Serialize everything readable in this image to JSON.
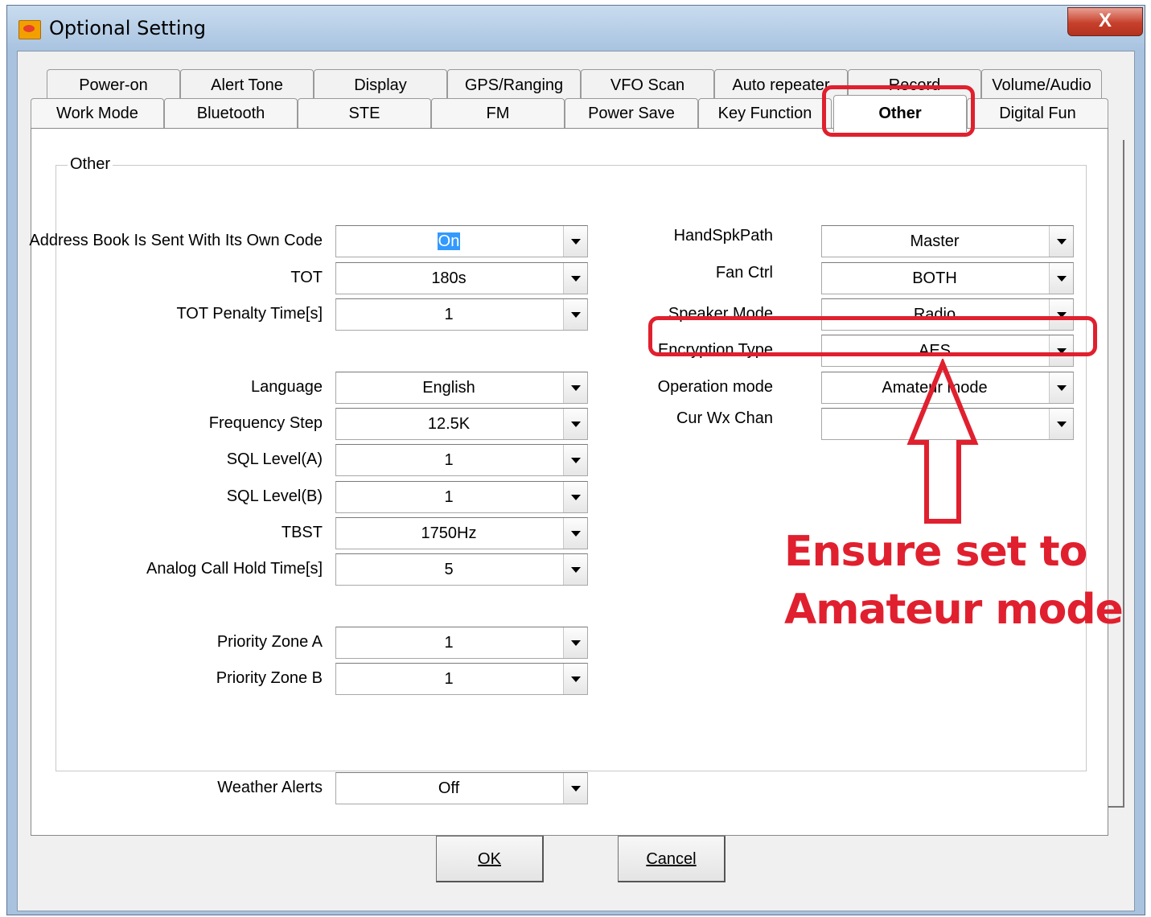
{
  "window": {
    "title": "Optional Setting",
    "close_label": "X"
  },
  "tabs_row1": [
    "Power-on",
    "Alert Tone",
    "Display",
    "GPS/Ranging",
    "VFO Scan",
    "Auto repeater",
    "Record",
    "Volume/Audio"
  ],
  "tabs_row2": [
    "Work Mode",
    "Bluetooth",
    "STE",
    "FM",
    "Power Save",
    "Key Function",
    "Other",
    "Digital Fun"
  ],
  "active_tab": "Other",
  "group_label": "Other",
  "left_fields": [
    {
      "label": "Address Book Is Sent With Its Own Code",
      "value": "On"
    },
    {
      "label": "TOT",
      "value": "180s"
    },
    {
      "label": "TOT Penalty Time[s]",
      "value": "1"
    },
    {
      "label": "Language",
      "value": "English"
    },
    {
      "label": "Frequency Step",
      "value": "12.5K"
    },
    {
      "label": "SQL Level(A)",
      "value": "1"
    },
    {
      "label": "SQL Level(B)",
      "value": "1"
    },
    {
      "label": "TBST",
      "value": "1750Hz"
    },
    {
      "label": "Analog Call Hold Time[s]",
      "value": "5"
    },
    {
      "label": "Priority Zone A",
      "value": "1"
    },
    {
      "label": "Priority Zone B",
      "value": "1"
    },
    {
      "label": "Weather Alerts",
      "value": "Off"
    }
  ],
  "right_fields": [
    {
      "label": "HandSpkPath",
      "value": "Master"
    },
    {
      "label": "Fan Ctrl",
      "value": "BOTH"
    },
    {
      "label": "Speaker Mode",
      "value": "Radio"
    },
    {
      "label": "Encryption Type",
      "value": "AES"
    },
    {
      "label": "Operation mode",
      "value": "Amateur mode"
    },
    {
      "label": "Cur Wx Chan",
      "value": ""
    }
  ],
  "buttons": {
    "ok": "OK",
    "cancel": "Cancel"
  },
  "annotation": {
    "line1": "Ensure set to",
    "line2": "Amateur mode",
    "color": "#e0202e"
  }
}
